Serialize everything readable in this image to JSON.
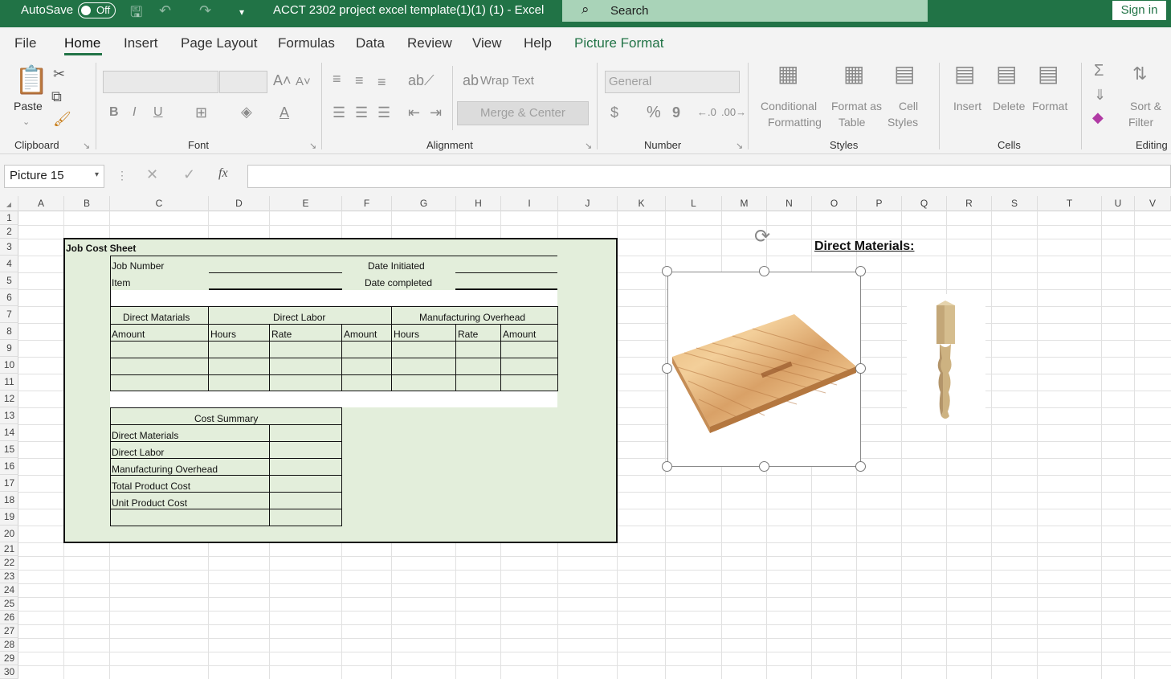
{
  "titlebar": {
    "autosave_label": "AutoSave",
    "autosave_state": "Off",
    "doc_title": "ACCT 2302 project excel template(1)(1) (1)  -  Excel",
    "search_placeholder": "Search",
    "signin_label": "Sign in"
  },
  "tabs": [
    "File",
    "Home",
    "Insert",
    "Page Layout",
    "Formulas",
    "Data",
    "Review",
    "View",
    "Help",
    "Picture Format"
  ],
  "ribbon": {
    "clipboard": {
      "paste": "Paste",
      "group": "Clipboard"
    },
    "font": {
      "group": "Font",
      "bold": "B",
      "italic": "I",
      "underline": "U"
    },
    "alignment": {
      "wrap_text": "Wrap Text",
      "merge_center": "Merge & Center",
      "group": "Alignment"
    },
    "number": {
      "format": "General",
      "group": "Number",
      "currency": "$",
      "percent": "%",
      "comma": "9"
    },
    "styles": {
      "conditional_1": "Conditional",
      "conditional_2": "Formatting",
      "format_table_1": "Format as",
      "format_table_2": "Table",
      "cell_styles_1": "Cell",
      "cell_styles_2": "Styles",
      "group": "Styles"
    },
    "cells": {
      "insert": "Insert",
      "delete": "Delete",
      "format": "Format",
      "group": "Cells"
    },
    "editing": {
      "sort_1": "Sort &",
      "sort_2": "Filter",
      "group": "Editing"
    }
  },
  "formula_bar": {
    "name_box": "Picture 15",
    "fx": "fx",
    "content": ""
  },
  "columns": [
    "A",
    "B",
    "C",
    "D",
    "E",
    "F",
    "G",
    "H",
    "I",
    "J",
    "K",
    "L",
    "M",
    "N",
    "O",
    "P",
    "Q",
    "R",
    "S",
    "T",
    "U",
    "V"
  ],
  "rows": [
    "1",
    "2",
    "3",
    "4",
    "5",
    "6",
    "7",
    "8",
    "9",
    "10",
    "11",
    "12",
    "13",
    "14",
    "15",
    "16",
    "17",
    "18",
    "19",
    "20",
    "21",
    "22",
    "23",
    "24",
    "25",
    "26",
    "27",
    "28",
    "29",
    "30"
  ],
  "sheet": {
    "job_cost_title": "Job Cost Sheet",
    "job_number": "Job Number",
    "date_initiated": "Date  Initiated",
    "item": "Item",
    "date_completed": "Date completed",
    "direct_materials_header": "Direct Matarials",
    "direct_labor_header": "Direct Labor",
    "overhead_header": "Manufacturing Overhead",
    "col_amount_1": "Amount",
    "col_hours_1": "Hours",
    "col_rate_1": "Rate",
    "col_amount_2": "Amount",
    "col_hours_2": "Hours",
    "col_rate_2": "Rate",
    "col_amount_3": "Amount",
    "cost_summary": "Cost Summary",
    "summary_rows": [
      "Direct Materials",
      "Direct Labor",
      "Manufacturing Overhead",
      "Total Product Cost",
      "Unit Product Cost"
    ],
    "direct_materials_label": "Direct Materials:"
  },
  "colors": {
    "excel_green": "#217346",
    "sheet_fill": "#e3eedb",
    "search_bg": "#a9d3b8"
  }
}
